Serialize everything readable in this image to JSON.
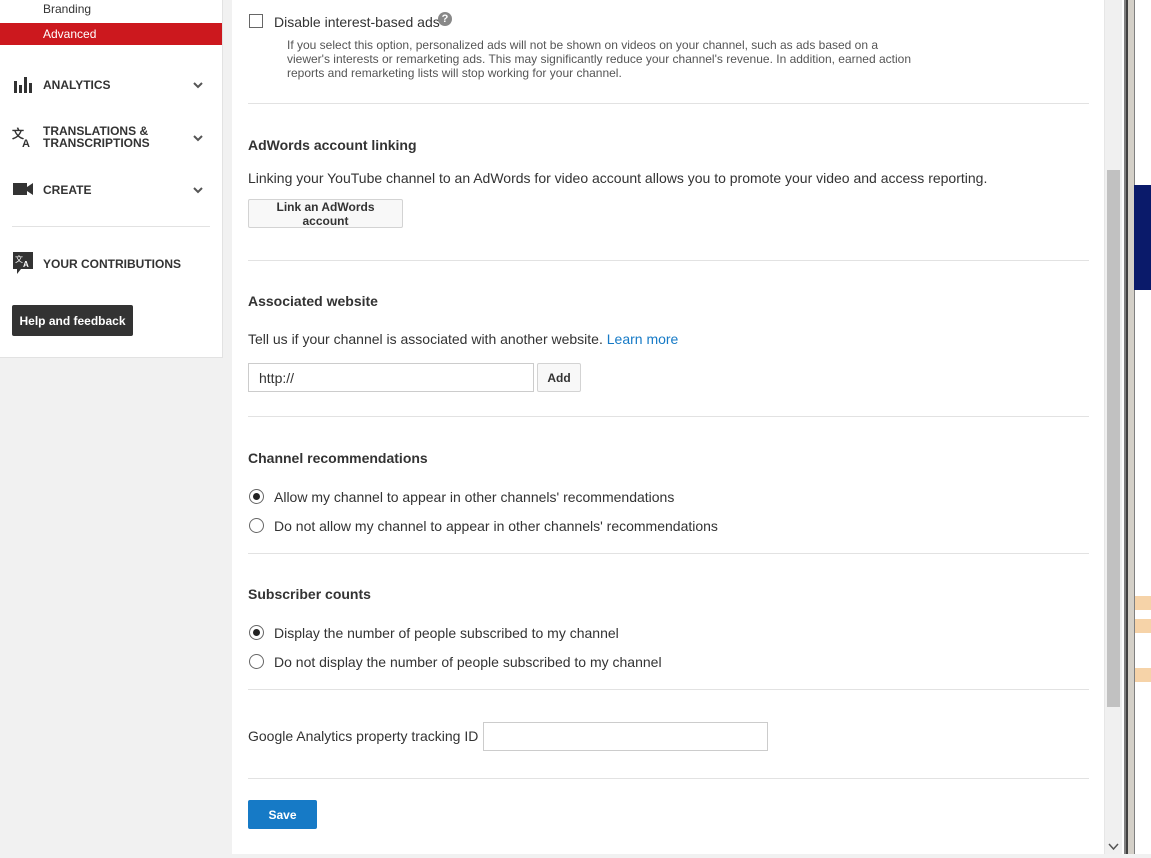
{
  "sidebar": {
    "sub_items": [
      "Branding",
      "Advanced"
    ],
    "nav": {
      "analytics": "ANALYTICS",
      "translations_line1": "TRANSLATIONS &",
      "translations_line2": "TRANSCRIPTIONS",
      "create": "CREATE",
      "contributions": "YOUR CONTRIBUTIONS"
    },
    "help_button": "Help and feedback",
    "active_color": "#cc181e"
  },
  "ads": {
    "checkbox_label": "Disable interest-based ads",
    "checked": false,
    "description": "If you select this option, personalized ads will not be shown on videos on your channel, such as ads based on a viewer's interests or remarketing ads. This may significantly reduce your channel's revenue. In addition, earned action reports and remarketing lists will stop working for your channel."
  },
  "adwords": {
    "title": "AdWords account linking",
    "text": "Linking your YouTube channel to an AdWords for video account allows you to promote your video and access reporting.",
    "button": "Link an AdWords account"
  },
  "website": {
    "title": "Associated website",
    "text": "Tell us if your channel is associated with another website.",
    "learn_more": "Learn more",
    "input_value": "http://",
    "add_button": "Add"
  },
  "recommendations": {
    "title": "Channel recommendations",
    "options": [
      {
        "label": "Allow my channel to appear in other channels' recommendations",
        "selected": true
      },
      {
        "label": "Do not allow my channel to appear in other channels' recommendations",
        "selected": false
      }
    ]
  },
  "subscribers": {
    "title": "Subscriber counts",
    "options": [
      {
        "label": "Display the number of people subscribed to my channel",
        "selected": true
      },
      {
        "label": "Do not display the number of people subscribed to my channel",
        "selected": false
      }
    ]
  },
  "analytics": {
    "label": "Google Analytics property tracking ID",
    "value": ""
  },
  "save_button": "Save",
  "colors": {
    "link": "#167ac6",
    "primary_button": "#167ac6",
    "sidebar_active": "#cc181e"
  }
}
